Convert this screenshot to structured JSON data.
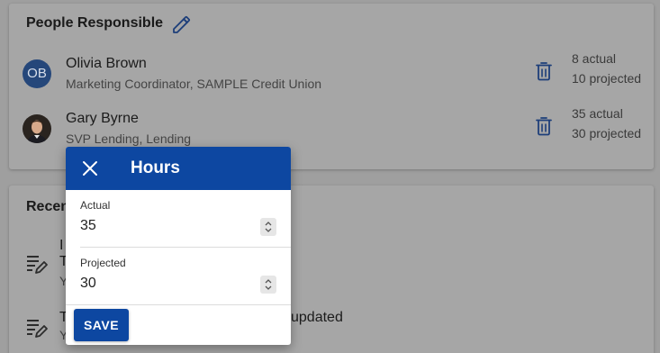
{
  "people_card": {
    "title": "People Responsible",
    "edit_icon": "pencil-icon",
    "people": [
      {
        "initials": "OB",
        "name": "Olivia Brown",
        "role": "Marketing Coordinator, SAMPLE Credit Union",
        "actual": "8 actual",
        "projected": "10 projected"
      },
      {
        "avatar": "photo",
        "name": "Gary Byrne",
        "role": "SVP Lending, Lending",
        "actual": "35 actual",
        "projected": "30 projected"
      }
    ]
  },
  "recent_card": {
    "title_visible": "Recen",
    "items": [
      {
        "icon": "document-edit-icon",
        "line1": "I",
        "line2": "T",
        "sub": "Y"
      },
      {
        "icon": "document-edit-icon",
        "line1": "T",
        "line1_tail": "updated",
        "sub": "Y"
      }
    ]
  },
  "dialog": {
    "title": "Hours",
    "close_icon": "close-icon",
    "fields": {
      "actual": {
        "label": "Actual",
        "value": "35"
      },
      "projected": {
        "label": "Projected",
        "value": "30"
      }
    },
    "save_label": "SAVE"
  },
  "colors": {
    "primary": "#0d47a1",
    "backdrop": "#9f9f9f",
    "icon_blue": "#1e3f7a"
  }
}
